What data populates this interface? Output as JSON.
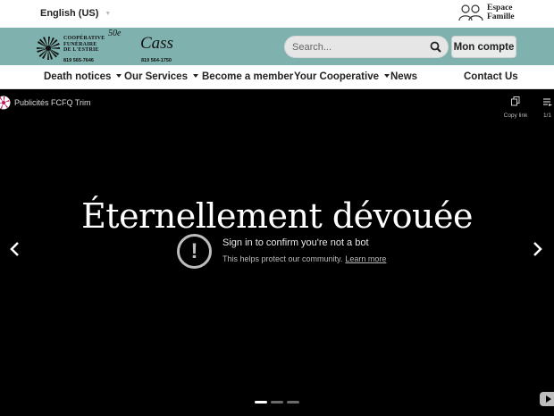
{
  "topbar": {
    "language": "English (US)",
    "espace_famille_line1": "Espace",
    "espace_famille_line2": "Famille"
  },
  "brand": {
    "coop_name_line1": "COOPÉRATIVE",
    "coop_name_line2": "FUNÉRAIRE",
    "coop_name_line3": "DE L'ESTRIE",
    "coop_phone": "819 565-7646",
    "anniversary": "50e",
    "cass_name": "Cass",
    "cass_phone": "819 564-1750",
    "teal": "#7fb1ae"
  },
  "search": {
    "placeholder": "Search..."
  },
  "account_button": "Mon compte",
  "nav": {
    "death_notices": "Death notices",
    "our_services": "Our Services",
    "become_member": "Become a member",
    "your_cooperative": "Your Cooperative",
    "news": "News",
    "contact": "Contact Us"
  },
  "video": {
    "channel_title": "Publicités FCFQ Trim",
    "copy_link": "Copy link",
    "queue_count": "1/1",
    "hero_text": "Éternellement dévouée",
    "bot_title": "Sign in to confirm you're not a bot",
    "bot_subtitle": "This helps protect our community.",
    "learn_more": "Learn more",
    "slides_total": 3,
    "active_slide": 1
  }
}
